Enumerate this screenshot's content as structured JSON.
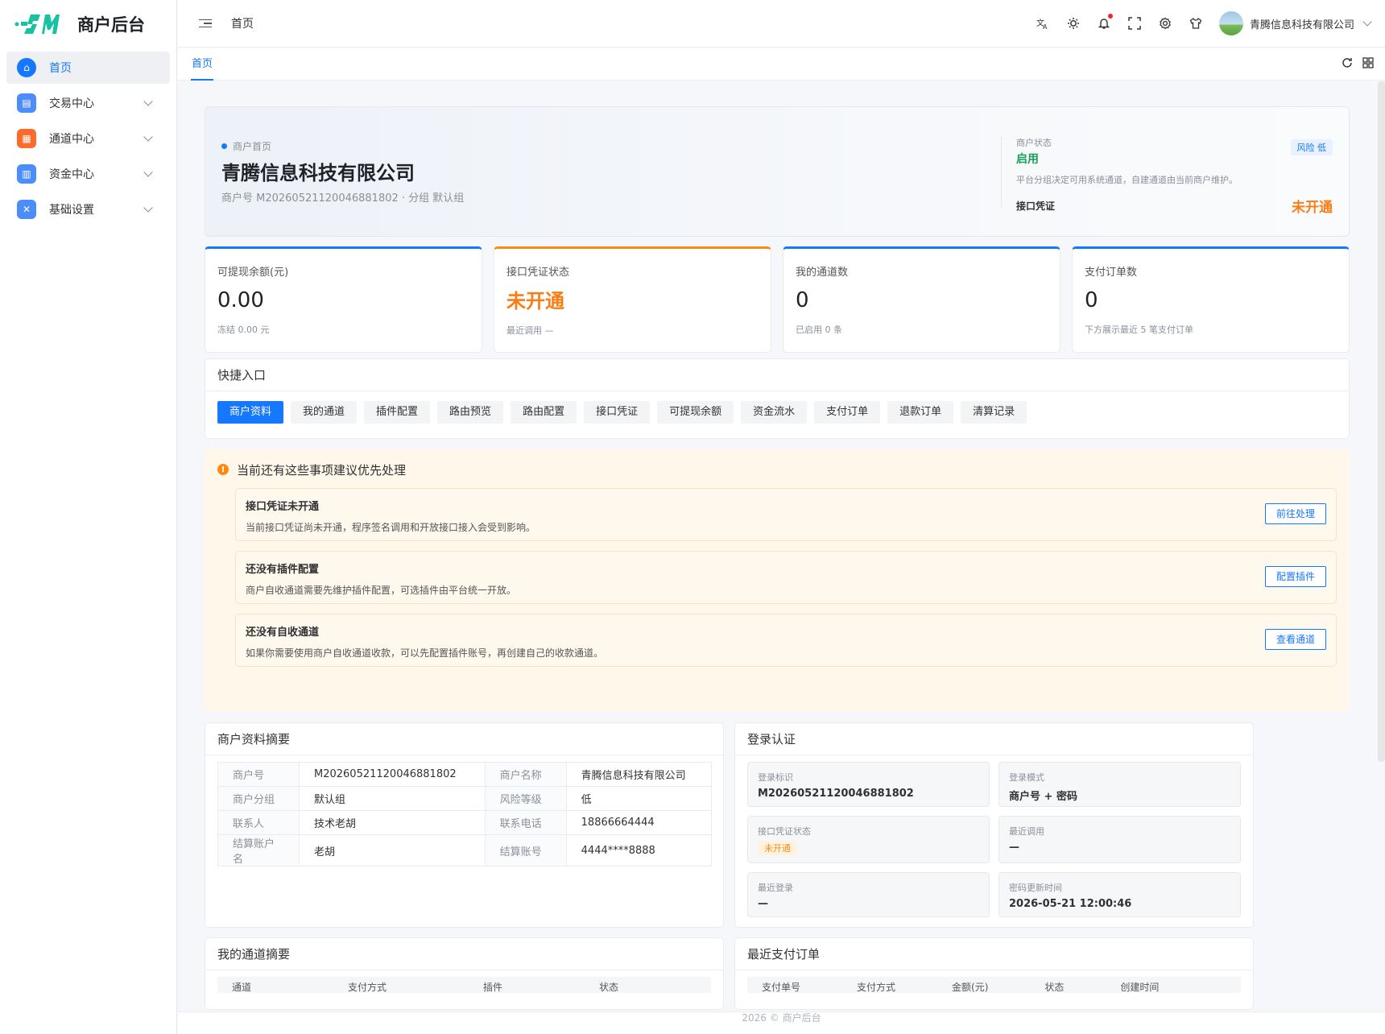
{
  "app": {
    "title": "商户后台"
  },
  "sidebar": {
    "items": [
      {
        "label": "首页",
        "icon": "home-icon",
        "color": "#1677ff",
        "active": true
      },
      {
        "label": "交易中心",
        "icon": "clipboard-icon",
        "color": "#4c8dfa"
      },
      {
        "label": "通道中心",
        "icon": "channel-icon",
        "color": "#fa6b2c"
      },
      {
        "label": "资金中心",
        "icon": "document-icon",
        "color": "#4c8dfa"
      },
      {
        "label": "基础设置",
        "icon": "tools-icon",
        "color": "#4c8dfa"
      }
    ]
  },
  "header": {
    "breadcrumb": "首页",
    "user": "青腾信息科技有限公司"
  },
  "tabs": {
    "active": "首页"
  },
  "hero": {
    "tag": "商户首页",
    "name": "青腾信息科技有限公司",
    "sub": "商户号 M2026052112004688180​2 · 分组 默认组",
    "status_label": "商户状态",
    "status_value": "启用",
    "risk": "风险 低",
    "note": "平台分组决定可用系统通道，自建通道由当前商户维护。",
    "cred_label": "接口凭证",
    "cred_value": "未开通"
  },
  "stats": [
    {
      "label": "可提现余额(元)",
      "value": "0.00",
      "sub": "冻结 0.00 元"
    },
    {
      "label": "接口凭证状态",
      "value": "未开通",
      "sub": "最近调用 —"
    },
    {
      "label": "我的通道数",
      "value": "0",
      "sub": "已启用 0 条"
    },
    {
      "label": "支付订单数",
      "value": "0",
      "sub": "下方展示最近 5 笔支付订单"
    }
  ],
  "quick": {
    "title": "快捷入口",
    "items": [
      "商户资料",
      "我的通道",
      "插件配置",
      "路由预览",
      "路由配置",
      "接口凭证",
      "可提现余额",
      "资金流水",
      "支付订单",
      "退款订单",
      "清算记录"
    ]
  },
  "todo": {
    "title": "当前还有这些事项建议优先处理",
    "items": [
      {
        "title": "接口凭证未开通",
        "desc": "当前接口凭证尚未开通，程序签名调用和开放接口接入会受到影响。",
        "button": "前往处理"
      },
      {
        "title": "还没有插件配置",
        "desc": "商户自收通道需要先维护插件配置，可选插件由平台统一开放。",
        "button": "配置插件"
      },
      {
        "title": "还没有自收通道",
        "desc": "如果你需要使用商户自收通道收款，可以先配置插件账号，再创建自己的收款通道。",
        "button": "查看通道"
      }
    ]
  },
  "summary": {
    "title": "商户资料摘要",
    "rows": [
      [
        "商户号",
        "M2026052112004688180​2",
        "商户名称",
        "青腾信息科技有限公司"
      ],
      [
        "商户分组",
        "默认组",
        "风险等级",
        "低"
      ],
      [
        "联系人",
        "技术老胡",
        "联系电话",
        "18866664444"
      ],
      [
        "结算账户名",
        "老胡",
        "结算账号",
        "4444****8888"
      ]
    ]
  },
  "login": {
    "title": "登录认证",
    "id_label": "登录标识",
    "id_value": "M2026052112004688180​2",
    "mode_label": "登录模式",
    "mode_value": "商户号 + 密码",
    "cred_label": "接口凭证状态",
    "cred_value": "未开通",
    "call_label": "最近调用",
    "call_value": "—",
    "last_label": "最近登录",
    "last_value": "—",
    "pwd_label": "密码更新时间",
    "pwd_value": "2026-05-21 12:00:46"
  },
  "channels": {
    "title": "我的通道摘要",
    "cols": [
      "通道",
      "支付方式",
      "插件",
      "状态"
    ]
  },
  "orders": {
    "title": "最近支付订单",
    "cols": [
      "支付单号",
      "支付方式",
      "金额(元)",
      "状态",
      "创建时间"
    ]
  },
  "footer": "2026 © 商户后台"
}
